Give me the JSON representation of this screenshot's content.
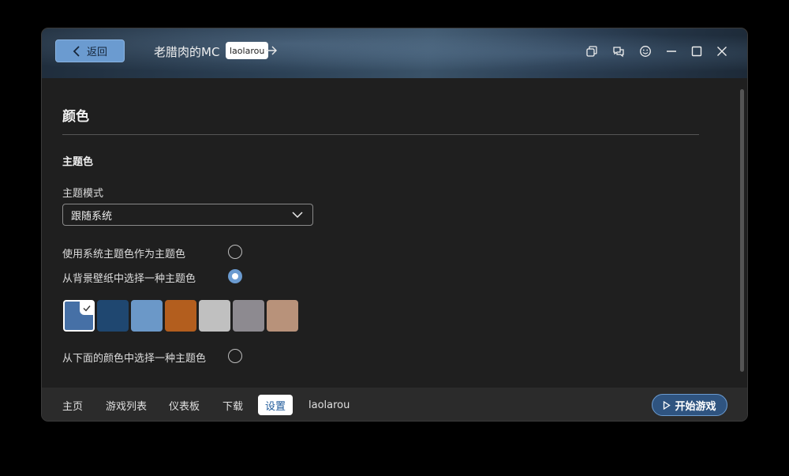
{
  "titlebar": {
    "back_label": "返回",
    "app_title": "老腊肉的MC",
    "user_chip": "laolarou"
  },
  "content": {
    "section_title": "颜色",
    "sub_title": "主题色",
    "mode_label": "主题模式",
    "mode_value": "跟随系统",
    "options": [
      {
        "label": "使用系统主题色作为主题色",
        "selected": false
      },
      {
        "label": "从背景壁纸中选择一种主题色",
        "selected": true
      },
      {
        "label": "从下面的颜色中选择一种主题色",
        "selected": false
      }
    ],
    "swatches": [
      "#4670a6",
      "#1f4770",
      "#6b98c8",
      "#b35e1e",
      "#c0c0c0",
      "#8d8a90",
      "#b8927a"
    ],
    "selected_swatch": 0
  },
  "bottom_nav": {
    "items": [
      "主页",
      "游戏列表",
      "仪表板",
      "下载",
      "设置",
      "laolarou"
    ],
    "active": "设置",
    "play_label": "开始游戏"
  },
  "colors": {
    "accent": "#6b9bd0",
    "background": "#1f1f1f"
  }
}
